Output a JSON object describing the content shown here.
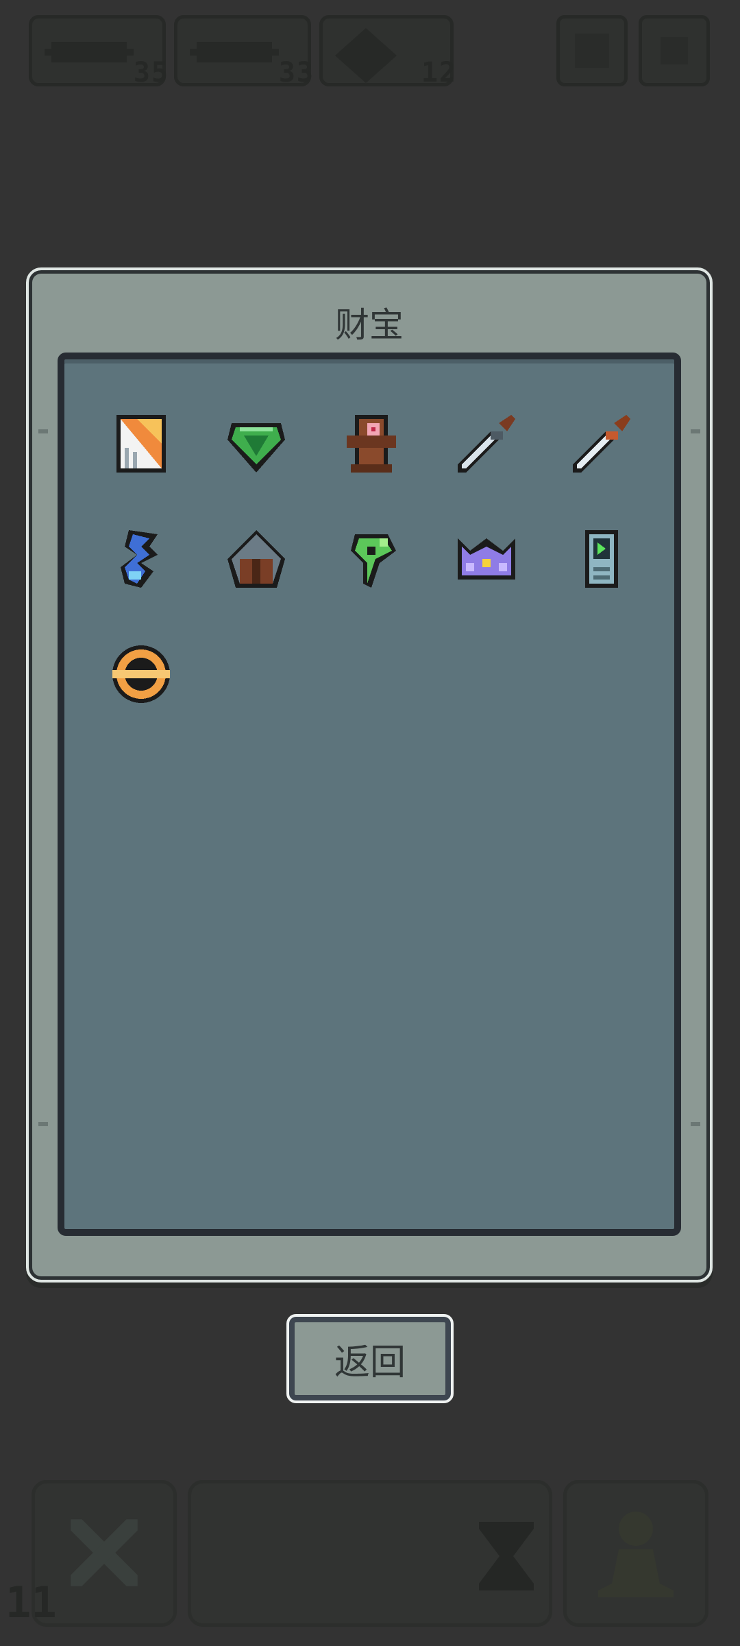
{
  "hud": {
    "resources": [
      {
        "icon": "scroll-icon",
        "count": "35"
      },
      {
        "icon": "scroll-icon",
        "count": "33"
      },
      {
        "icon": "crystal-icon",
        "count": "12"
      }
    ],
    "buttons": [
      {
        "icon": "map-icon"
      },
      {
        "icon": "settings-icon"
      }
    ]
  },
  "dialog": {
    "title": "财宝",
    "items": [
      {
        "icon": "torn-card-icon"
      },
      {
        "icon": "emerald-gem-icon"
      },
      {
        "icon": "totem-icon"
      },
      {
        "icon": "dagger-icon"
      },
      {
        "icon": "sword-icon"
      },
      {
        "icon": "blue-flame-icon"
      },
      {
        "icon": "lantern-icon"
      },
      {
        "icon": "green-sprout-icon"
      },
      {
        "icon": "purple-crown-icon"
      },
      {
        "icon": "handheld-device-icon"
      },
      {
        "icon": "golden-ring-icon"
      }
    ]
  },
  "back_button": {
    "label": "返回"
  },
  "bottom_bar": {
    "round_counter": "11",
    "slots": [
      {
        "icon": "crossed-swords-icon"
      },
      {
        "icon": "hourglass-icon"
      },
      {
        "icon": "pawn-icon"
      }
    ]
  },
  "colors": {
    "background": "#333333",
    "dialog_frame": "#8c9994",
    "inventory_panel": "#5d747c"
  }
}
